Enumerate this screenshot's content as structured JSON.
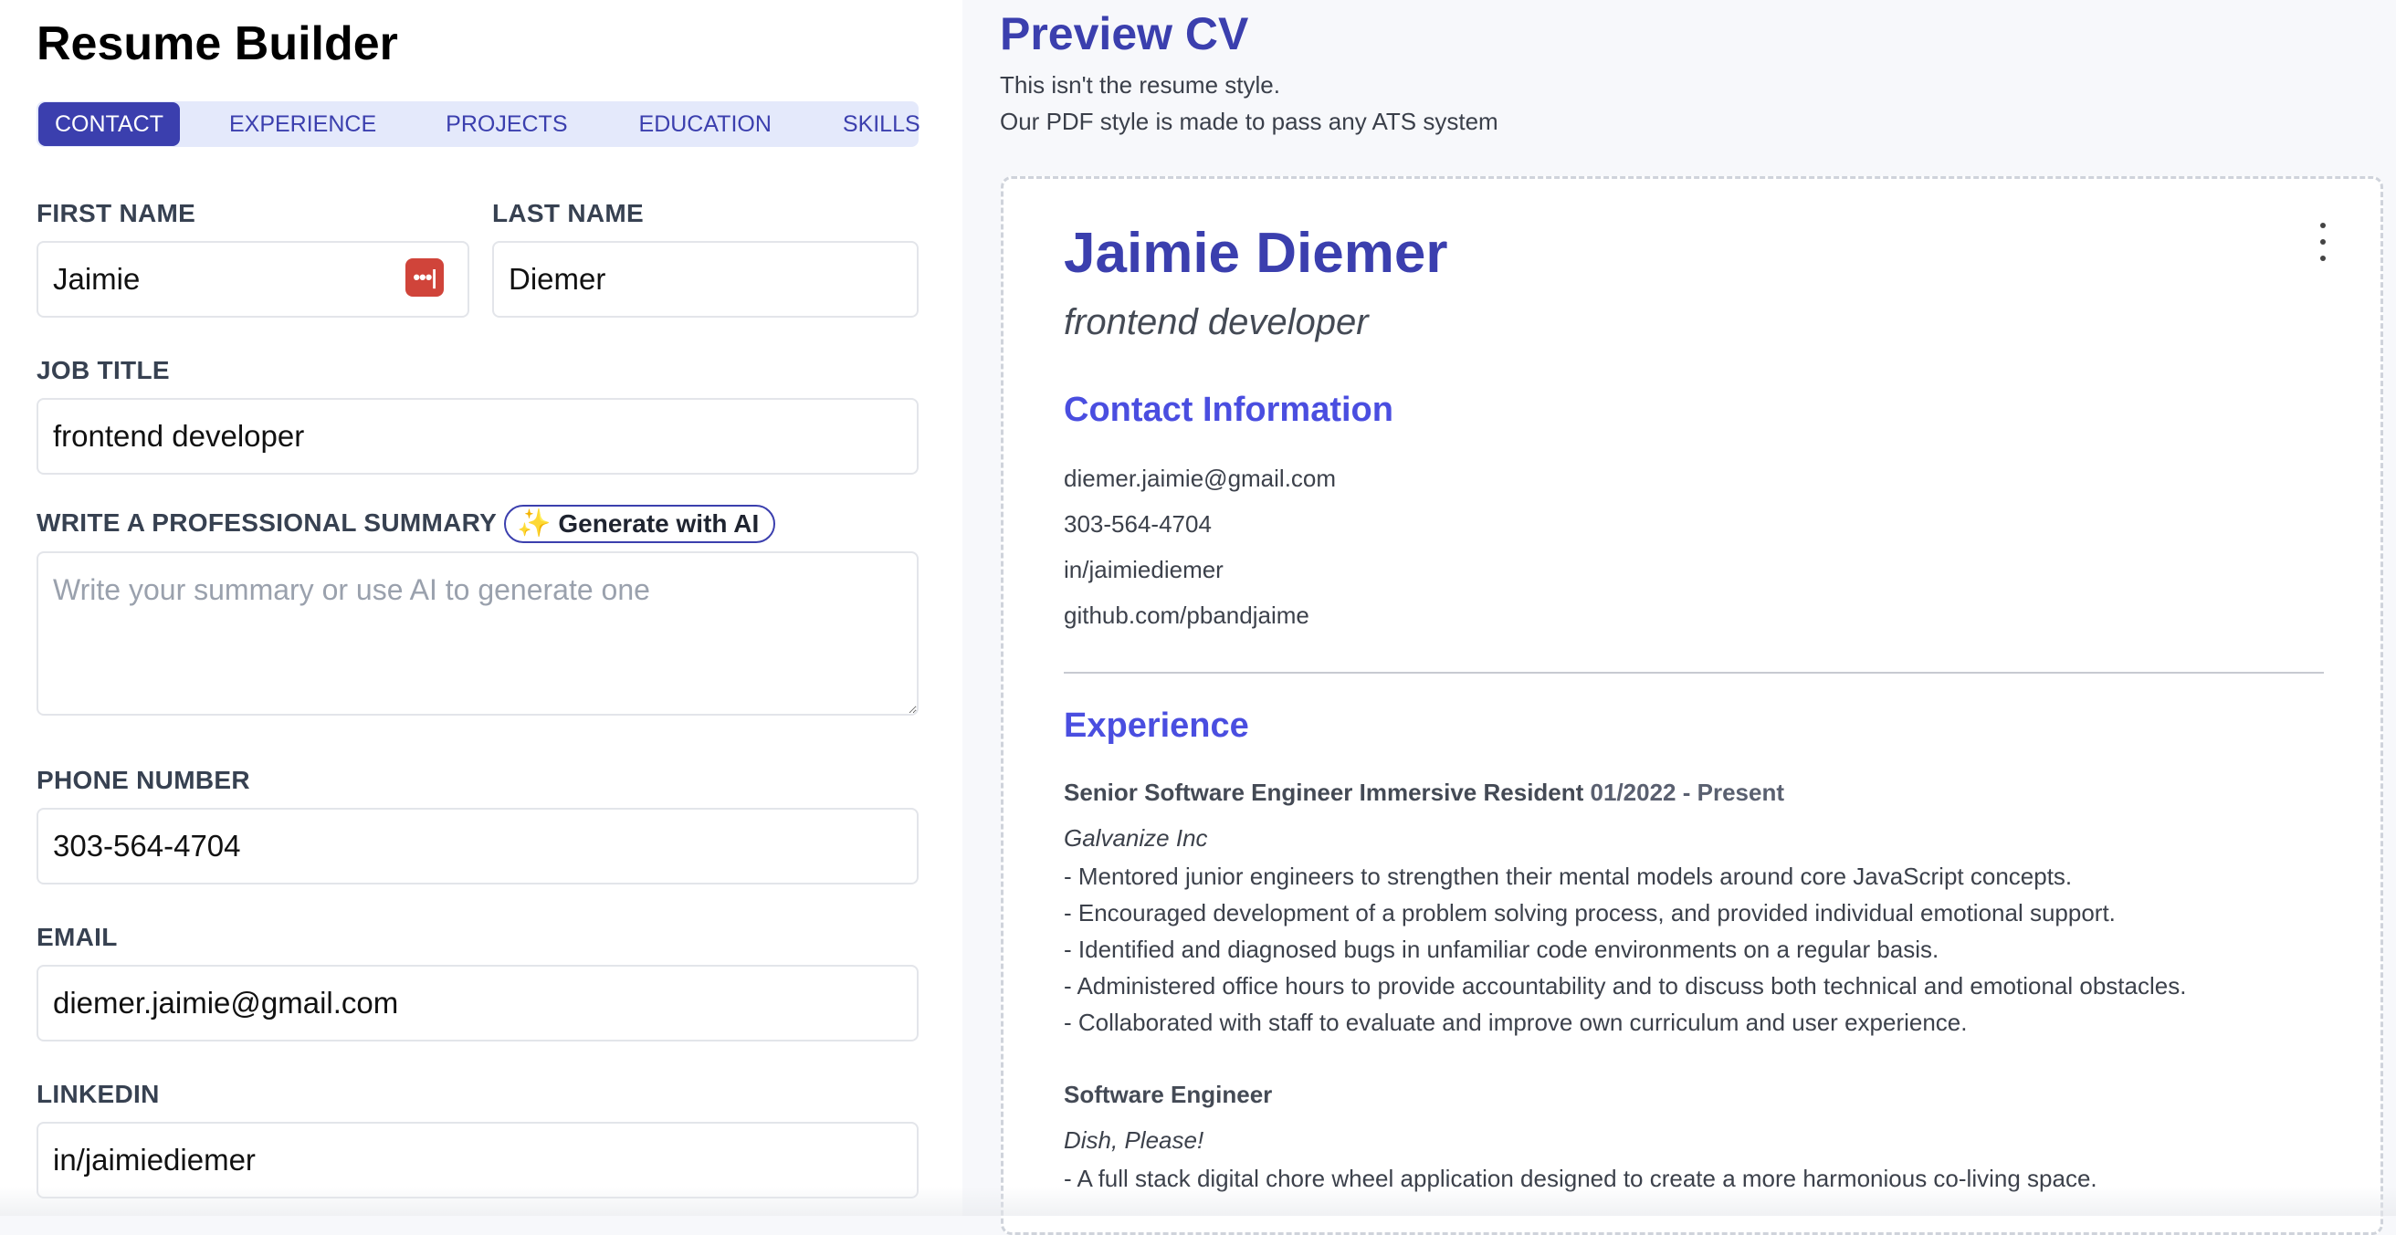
{
  "app": {
    "title": "Resume Builder"
  },
  "tabs": [
    {
      "label": "CONTACT",
      "active": true
    },
    {
      "label": "EXPERIENCE",
      "active": false
    },
    {
      "label": "PROJECTS",
      "active": false
    },
    {
      "label": "EDUCATION",
      "active": false
    },
    {
      "label": "SKILLS",
      "active": false
    }
  ],
  "form": {
    "first_name": {
      "label": "FIRST NAME",
      "value": "Jaimie"
    },
    "last_name": {
      "label": "LAST NAME",
      "value": "Diemer"
    },
    "job_title": {
      "label": "JOB TITLE",
      "value": "frontend developer"
    },
    "summary": {
      "label": "WRITE A PROFESSIONAL SUMMARY",
      "value": "",
      "placeholder": "Write your summary or use AI to generate one",
      "ai_button": "Generate with AI"
    },
    "phone": {
      "label": "PHONE NUMBER",
      "value": "303-564-4704"
    },
    "email": {
      "label": "EMAIL",
      "value": "diemer.jaimie@gmail.com"
    },
    "linkedin": {
      "label": "LINKEDIN",
      "value": "in/jaimiediemer"
    }
  },
  "preview": {
    "title": "Preview CV",
    "note_line1": "This isn't the resume style.",
    "note_line2": "Our PDF style is made to pass any ATS system",
    "cv": {
      "name": "Jaimie Diemer",
      "job_title": "frontend developer",
      "contact_heading": "Contact Information",
      "contacts": [
        "diemer.jaimie@gmail.com",
        "303-564-4704",
        "in/jaimiediemer",
        "github.com/pbandjaime"
      ],
      "experience_heading": "Experience",
      "jobs": [
        {
          "role": "Senior Software Engineer Immersive Resident",
          "dates": "01/2022 - Present",
          "company": "Galvanize Inc",
          "bullets": [
            "- Mentored junior engineers to strengthen their mental models around core JavaScript concepts.",
            "- Encouraged development of a problem solving process, and provided individual emotional support.",
            "- Identified and diagnosed bugs in unfamiliar code environments on a regular basis.",
            "- Administered office hours to provide accountability and to discuss both technical and emotional obstacles.",
            "- Collaborated with staff to evaluate and improve own curriculum and user experience."
          ]
        },
        {
          "role": "Software Engineer",
          "company": "Dish, Please!",
          "bullets": [
            "- A full stack digital chore wheel application designed to create a more harmonious co-living space."
          ]
        }
      ]
    }
  },
  "colors": {
    "accent": "#3b3fae",
    "heading": "#4a4ee0",
    "tab_bg": "#e4e9fb",
    "badge": "#d0443a"
  },
  "icons": {
    "password_manager": "password-key-icon",
    "ai": "sparkles-icon",
    "menu": "kebab-menu-icon"
  }
}
